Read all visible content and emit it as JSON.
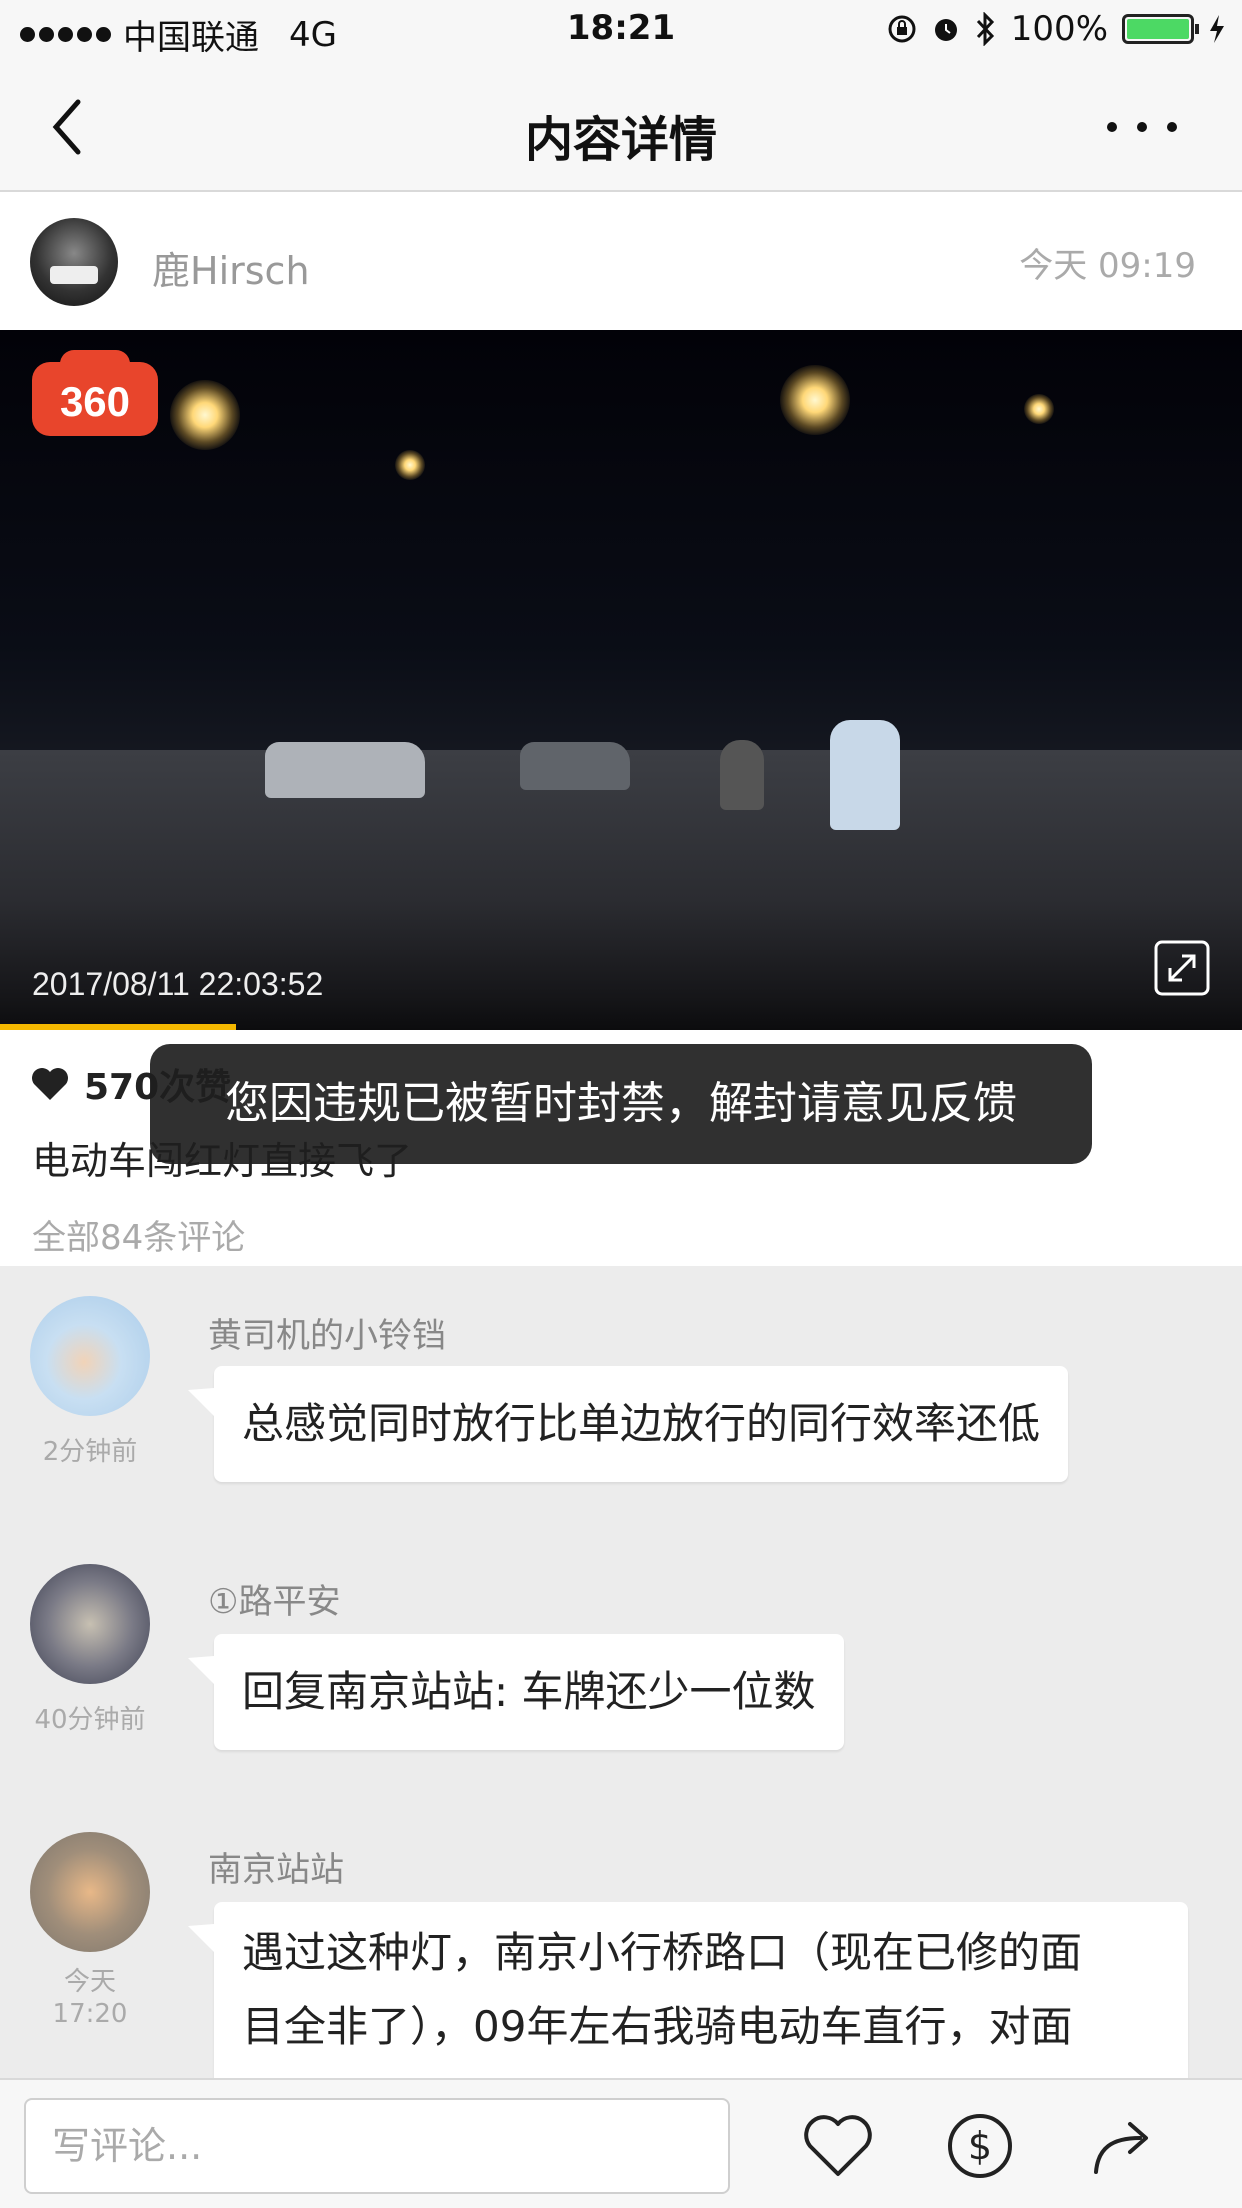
{
  "status_bar": {
    "carrier": "中国联通",
    "network": "4G",
    "time": "18:21",
    "battery": "100%"
  },
  "nav": {
    "title": "内容详情"
  },
  "post": {
    "author": "鹿Hirsch",
    "time": "今天 09:19",
    "video": {
      "logo": "360",
      "timestamp": "2017/08/11  22:03:52",
      "progress": 0.19
    },
    "likes": "570次赞",
    "caption": "电动车闯红灯直接飞了",
    "comment_count": "全部84条评论"
  },
  "toast": "您因违规已被暂时封禁，解封请意见反馈",
  "comments": [
    {
      "name": "黄司机的小铃铛",
      "when": "2分钟前",
      "text": "总感觉同时放行比单边放行的同行效率还低"
    },
    {
      "name": "①路平安",
      "when": "40分钟前",
      "text": "回复南京站站: 车牌还少一位数"
    },
    {
      "name": "南京站站",
      "when_line1": "今天",
      "when_line2": "17:20",
      "text_line1": "遇过这种灯，南京小行桥路口（现在已修的面",
      "text_line2": "目全非了），09年左右我骑电动车直行，对面"
    }
  ],
  "comment_input": {
    "placeholder": "写评论..."
  },
  "colors": {
    "accent": "#f5b800",
    "logo_red": "#e8452c",
    "battery_green": "#4cd964"
  }
}
